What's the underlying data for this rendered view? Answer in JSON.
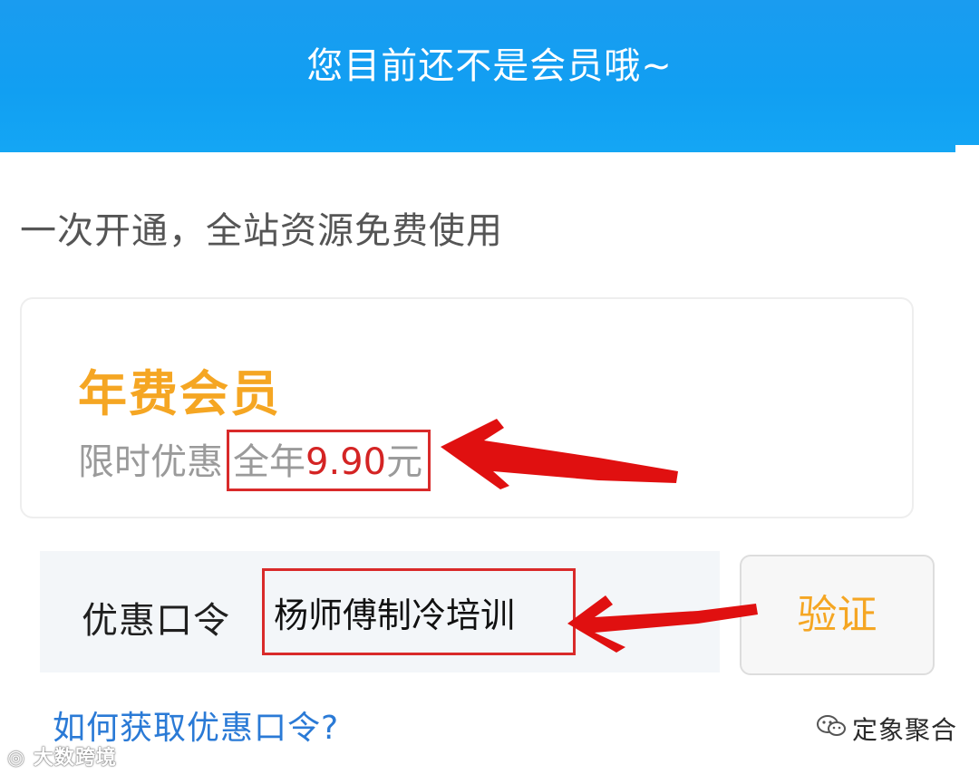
{
  "header": {
    "title": "您目前还不是会员哦~",
    "background": "#119ff2"
  },
  "tagline": "一次开通，全站资源免费使用",
  "plan": {
    "name": "年费会员",
    "promo_label": "限时优惠",
    "price_prefix": "全年",
    "price_value": "9.90",
    "price_unit": "元",
    "accent": "#f5a623",
    "price_color": "#d42424"
  },
  "coupon": {
    "label": "优惠口令",
    "value": "杨师傅制冷培训",
    "verify_label": "验证"
  },
  "help_link": "如何获取优惠口令?",
  "annotations": {
    "color": "#e01010",
    "icon": "red-arrow"
  },
  "watermarks": {
    "left": "大数跨境",
    "right": "定象聚合",
    "left_icon": "weibo-logo-icon",
    "right_icon": "wechat-icon"
  }
}
